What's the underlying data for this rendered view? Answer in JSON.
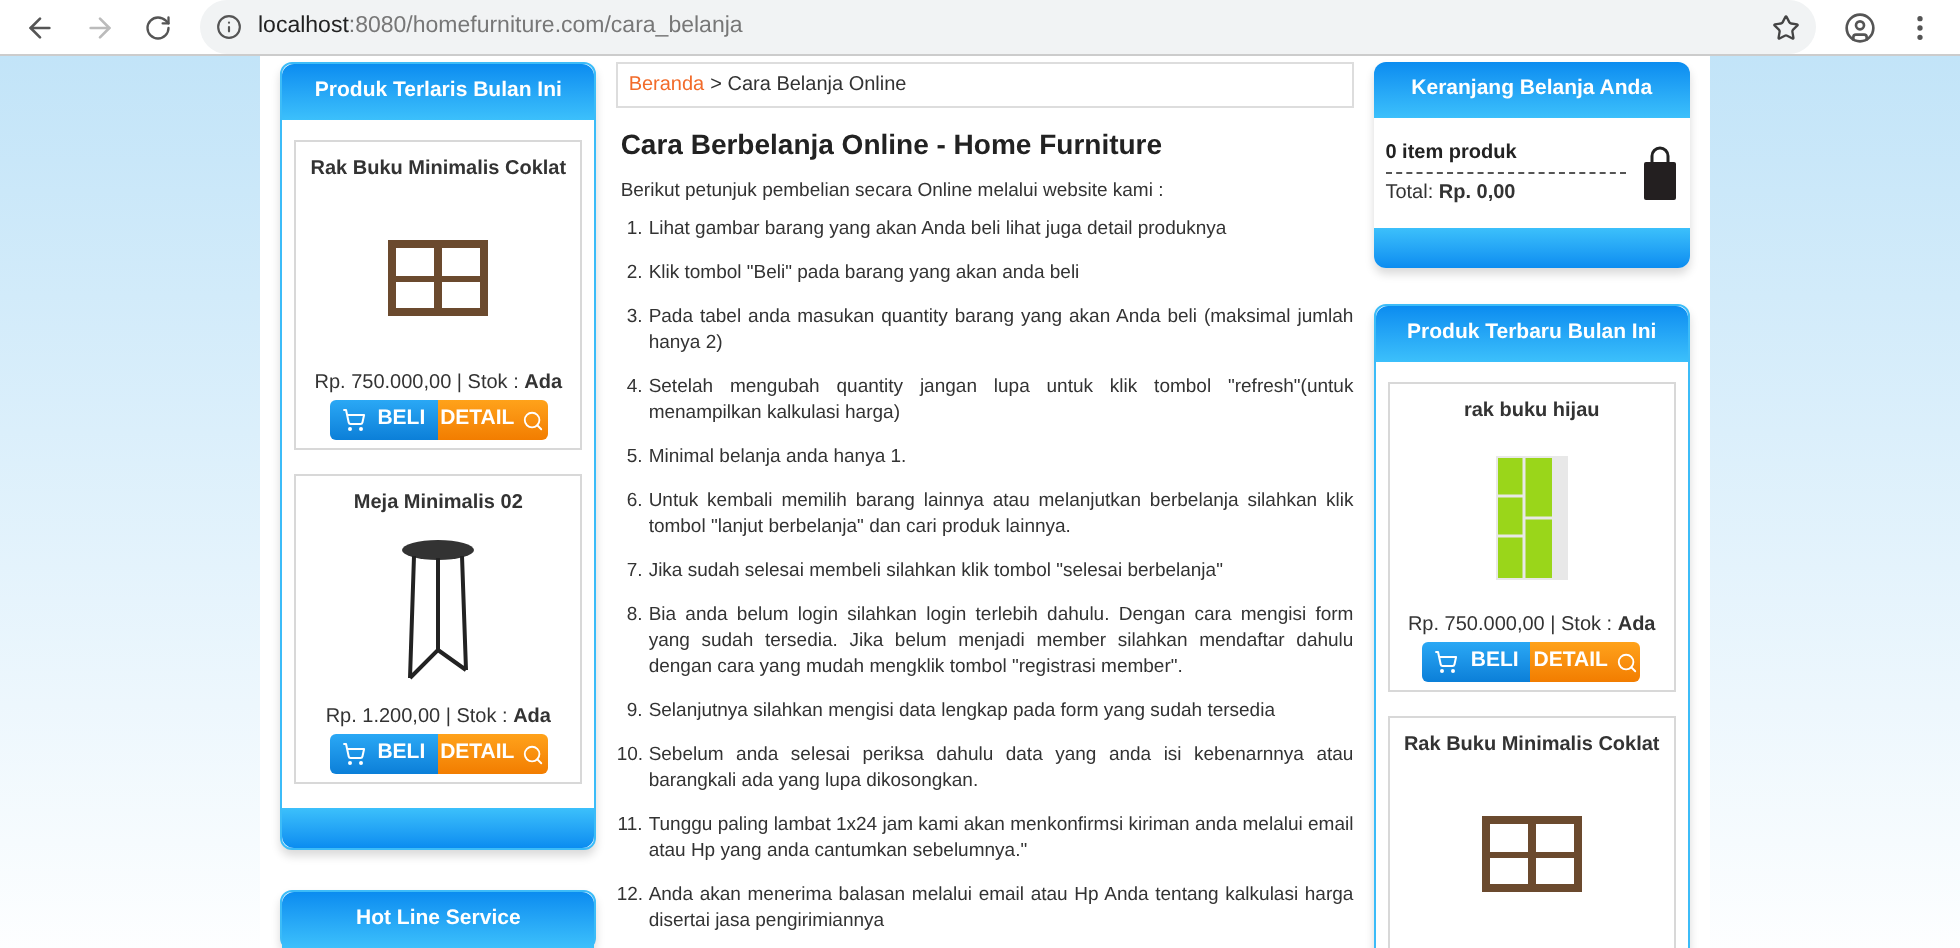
{
  "browser": {
    "url_host": "localhost",
    "url_rest": ":8080/homefurniture.com/cara_belanja"
  },
  "left_boxes": [
    {
      "title": "Produk Terlaris Bulan Ini",
      "products": [
        {
          "name": "Rak Buku Minimalis Coklat",
          "kind": "shelf_brown",
          "price": "Rp. 750.000,00 | Stok : **Ada**",
          "buy": "BELI",
          "detail": "DETAIL"
        },
        {
          "name": "Meja Minimalis 02",
          "kind": "stool",
          "price": "Rp. 1.200,00 | Stok : **Ada**",
          "buy": "BELI",
          "detail": "DETAIL"
        }
      ]
    },
    {
      "title": "Hot Line Service"
    }
  ],
  "breadcrumb": {
    "link": "Beranda",
    "rest": "> Cara Belanja Online"
  },
  "heading": "Cara Berbelanja Online - Home Furniture",
  "intro": "Berikut petunjuk pembelian secara Online melalui website kami :",
  "steps": [
    {
      "number": "1.",
      "text": "Lihat gambar barang yang akan Anda beli lihat juga detail produknya"
    },
    {
      "number": "2.",
      "text": "Klik tombol \"Beli\" pada barang yang akan anda beli"
    },
    {
      "number": "3.",
      "text": "Pada tabel anda masukan quantity barang yang akan Anda beli (maksimal jumlah hanya 2)"
    },
    {
      "number": "4.",
      "text": "Setelah mengubah quantity jangan lupa untuk klik tombol \"refresh\"(untuk menampilkan kalkulasi harga)"
    },
    {
      "number": "5.",
      "text": "Minimal belanja anda hanya 1."
    },
    {
      "number": "6.",
      "text": "Untuk kembali memilih barang lainnya atau melanjutkan berbelanja silahkan klik tombol \"lanjut berbelanja\" dan cari produk lainnya."
    },
    {
      "number": "7.",
      "text": "Jika sudah selesai membeli silahkan klik tombol \"selesai berbelanja\""
    },
    {
      "number": "8.",
      "text": "Bia anda belum login silahkan login terlebih dahulu. Dengan cara mengisi form yang sudah tersedia. Jika belum menjadi member silahkan mendaftar dahulu dengan cara yang mudah mengklik tombol \"registrasi member\"."
    },
    {
      "number": "9.",
      "text": "Selanjutnya silahkan mengisi data lengkap pada form yang sudah tersedia"
    },
    {
      "number": "10.",
      "text": "Sebelum anda selesai periksa dahulu data yang anda isi kebenarnnya atau barangkali ada yang lupa dikosongkan."
    },
    {
      "number": "11.",
      "text": "Tunggu paling lambat 1x24 jam kami akan menkonfirmsi kiriman anda melalui email atau Hp yang anda cantumkan sebelumnya.\""
    },
    {
      "number": "12.",
      "text": "Anda akan menerima balasan melalui email atau Hp Anda tentang kalkulasi harga disertai jasa pengirimiannya"
    }
  ],
  "cart": {
    "title": "Keranjang Belanja Anda",
    "items": "0 item produk",
    "total": "Total: **Rp. 0,00**"
  },
  "right_boxes": [
    {
      "title": "Produk Terbaru Bulan Ini",
      "products": [
        {
          "name": "rak buku hijau",
          "kind": "shelf_green",
          "price": "Rp. 750.000,00 | Stok : **Ada**",
          "buy": "BELI",
          "detail": "DETAIL"
        },
        {
          "name": "Rak Buku Minimalis Coklat",
          "kind": "shelf_brown"
        }
      ]
    }
  ]
}
